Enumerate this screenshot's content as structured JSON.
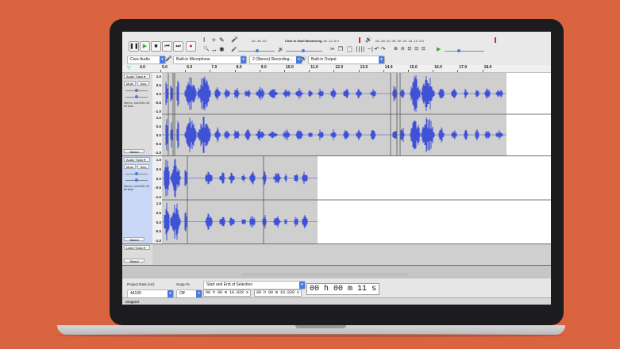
{
  "toolbar": {
    "buttons": [
      {
        "name": "pause-button",
        "glyph": "❚❚"
      },
      {
        "name": "play-button",
        "glyph": "▶"
      },
      {
        "name": "stop-button",
        "glyph": "■"
      },
      {
        "name": "skip-start-button",
        "glyph": "⏮"
      },
      {
        "name": "skip-end-button",
        "glyph": "⏭"
      },
      {
        "name": "record-button",
        "glyph": "●"
      }
    ],
    "record_meter_ticks": "-54  -48  -42",
    "monitor_label": "Click to Start Monitoring",
    "record_meter_ticks_right": "-18  -12  -6  0",
    "playback_meter_ticks": "-54  -48  -42  -36  -30  -24  -18  -12  -6  0",
    "tool_glyphs": {
      "select": "I",
      "envelope": "✧",
      "draw": "✎",
      "zoom": "🔍",
      "timeshift": "↔",
      "multi": "✱"
    },
    "edit_glyphs": "✂ ❐ 📋 |||| ~|~",
    "undo_glyphs": "↶ ↷",
    "zoom_glyphs": "⊕ ⊖ ⊡ ⊡ ⊡",
    "play_at_speed_glyph": "▶"
  },
  "devices": {
    "host": "Core Audio",
    "recording_device": "Built-in Microphone",
    "channels": "2 (Stereo) Recording...",
    "playback_device": "Built-in Output"
  },
  "ruler": {
    "start_label": "4.0",
    "ticks": [
      "5.0",
      "6.0",
      "7.0",
      "8.0",
      "9.0",
      "10.0",
      "11.0",
      "12.0",
      "13.0",
      "14.0",
      "15.0",
      "16.0",
      "17.0",
      "18.0"
    ]
  },
  "tracks": [
    {
      "name": "Audio Track",
      "mute": "Mute",
      "solo": "Solo",
      "info": "Stereo, 44100Hz 32-bit float",
      "select": "Select",
      "scale": [
        "1.0",
        "0.5",
        "0.0",
        "-0.5",
        "-1.0",
        "1.0",
        "0.5",
        "0.0",
        "-0.5",
        "-1.0"
      ]
    },
    {
      "name": "Audio Track",
      "mute": "Mute",
      "solo": "Solo",
      "info": "Stereo, 44100Hz 32-bit float",
      "select": "Select",
      "scale": [
        "1.0",
        "0.5",
        "0.0",
        "-0.5",
        "-1.0",
        "1.0",
        "0.5",
        "0.0",
        "-0.5",
        "-1.0"
      ]
    },
    {
      "name": "Label Track",
      "select": "Select"
    }
  ],
  "selection_toolbar": {
    "project_rate_label": "Project Rate (Hz)",
    "project_rate_value": "44100",
    "snap_to_label": "Snap-To",
    "snap_to_value": "Off",
    "mode_value": "Start and End of Selection",
    "start_time": "00 h 00 m 10.820 s",
    "end_time": "00 h 00 m 10.820 s",
    "audio_position": "00 h 00 m 11 s"
  },
  "status": "Stopped.",
  "colors": {
    "waveform": "#3f52d6",
    "selection": "#c8d8f6",
    "record": "#dd2222",
    "accent": "#4a7be0"
  }
}
